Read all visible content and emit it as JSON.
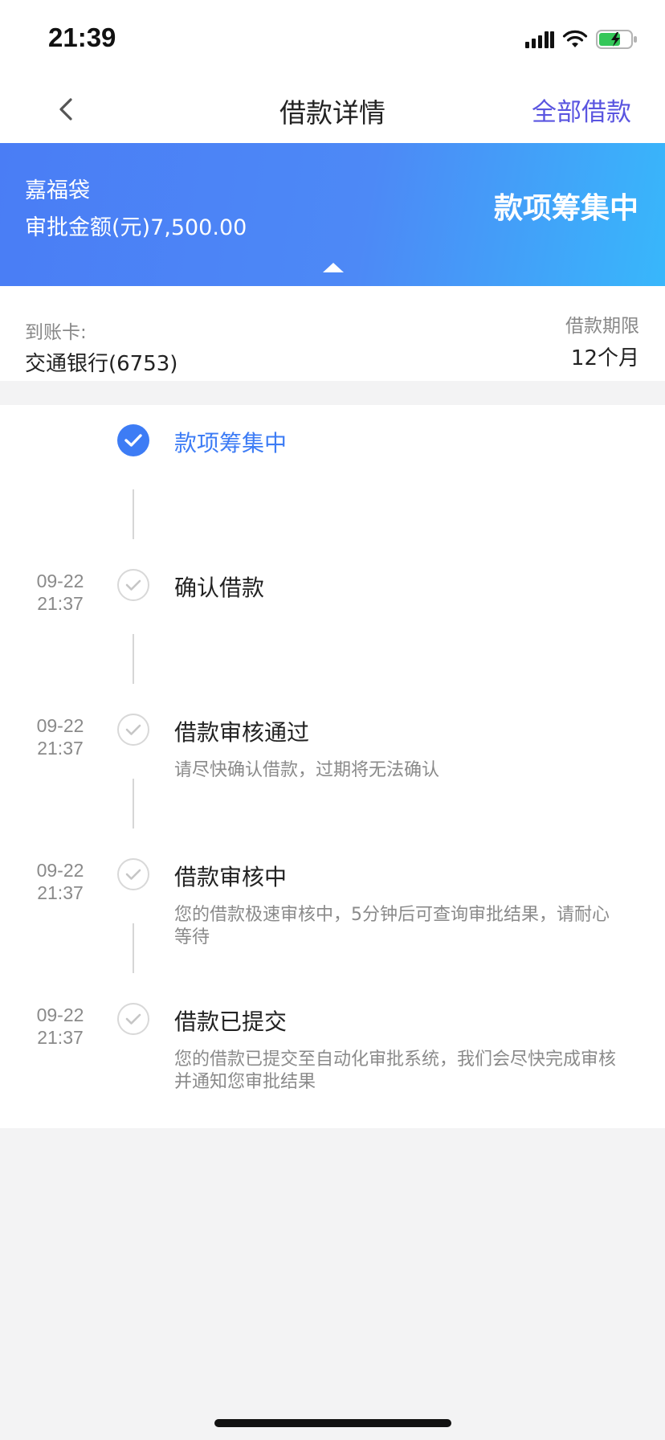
{
  "status_bar": {
    "time": "21:39"
  },
  "nav": {
    "title": "借款详情",
    "right_label": "全部借款",
    "back_icon": "chevron-left-icon"
  },
  "banner": {
    "product": "嘉福袋",
    "amount_label": "审批金额(元)7,500.00",
    "status": "款项筹集中",
    "colors": {
      "start": "#4a7df5",
      "end": "#38b7fb"
    }
  },
  "info": {
    "card_label": "到账卡:",
    "card_value": "交通银行(6753)",
    "term_label": "借款期限",
    "term_value": "12个月"
  },
  "timeline": [
    {
      "date": "",
      "time": "",
      "title": "款项筹集中",
      "desc": "",
      "state": "active"
    },
    {
      "date": "09-22",
      "time": "21:37",
      "title": "确认借款",
      "desc": "",
      "state": "done"
    },
    {
      "date": "09-22",
      "time": "21:37",
      "title": "借款审核通过",
      "desc": "请尽快确认借款，过期将无法确认",
      "state": "done"
    },
    {
      "date": "09-22",
      "time": "21:37",
      "title": "借款审核中",
      "desc": "您的借款极速审核中，5分钟后可查询审批结果，请耐心等待",
      "state": "done"
    },
    {
      "date": "09-22",
      "time": "21:37",
      "title": "借款已提交",
      "desc": "您的借款已提交至自动化审批系统，我们会尽快完成审核并通知您审批结果",
      "state": "done"
    }
  ],
  "colors": {
    "accent": "#3d7cf5",
    "nav_link": "#5a55e0"
  }
}
